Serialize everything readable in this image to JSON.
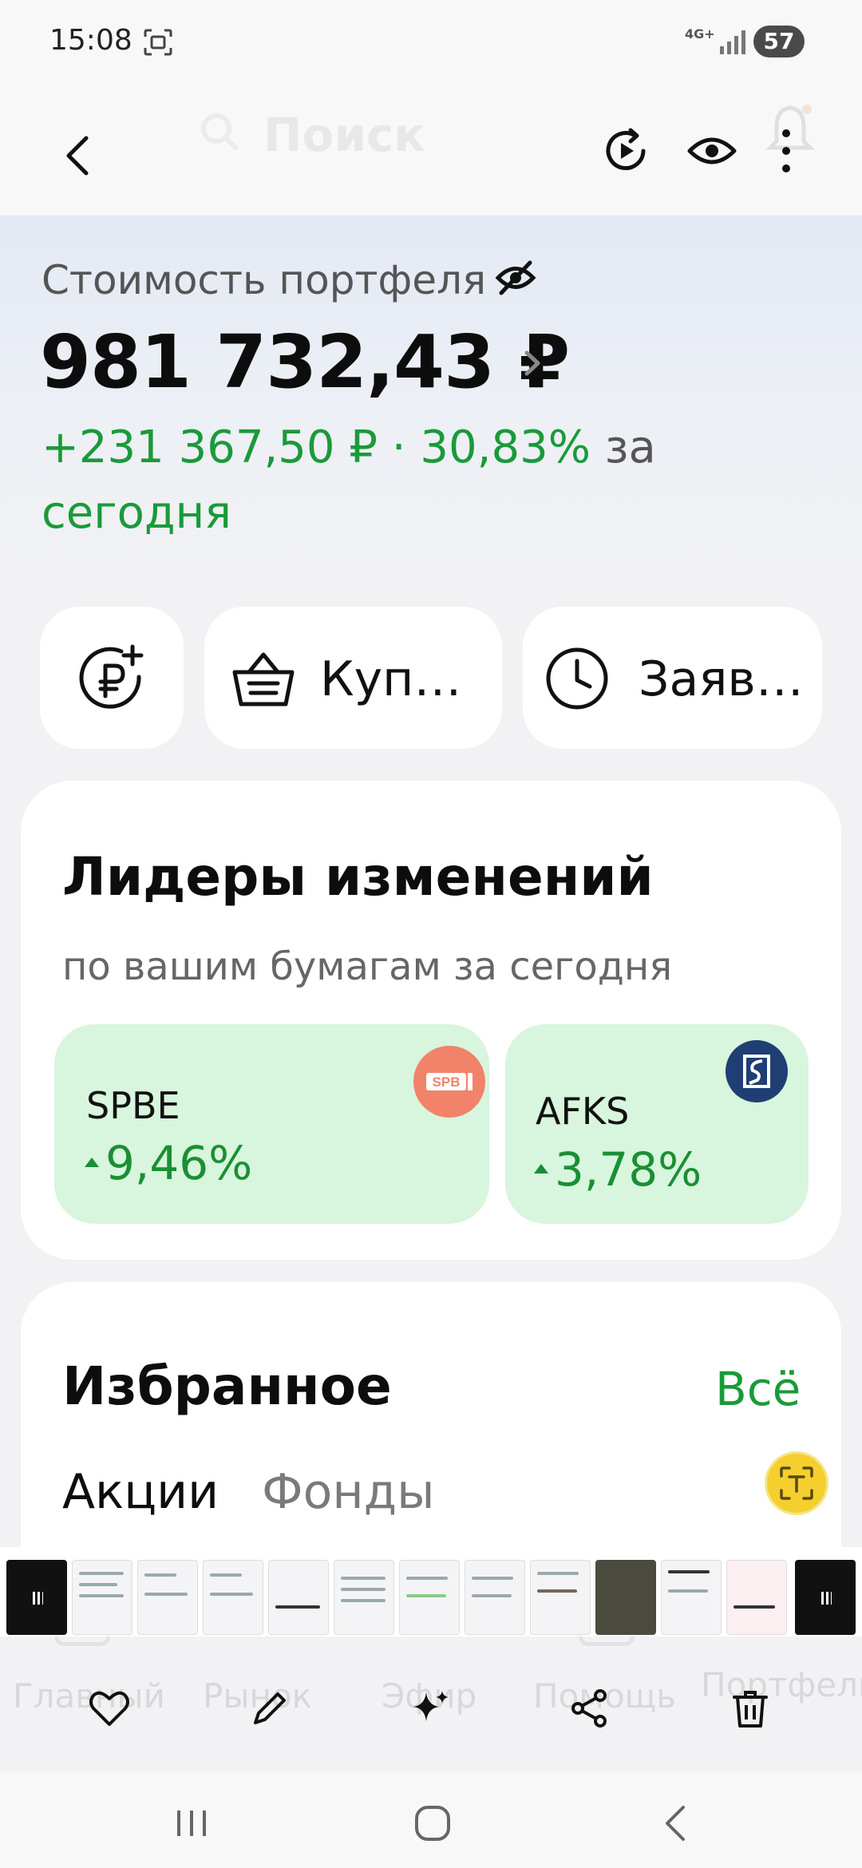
{
  "status_bar": {
    "time": "15:08",
    "network": "4G+",
    "battery": "57"
  },
  "header": {
    "ghost_search_placeholder": "Поиск",
    "icons": [
      "back-arrow-icon",
      "refresh-play-icon",
      "eye-icon",
      "more-vertical-icon",
      "bell-icon"
    ]
  },
  "portfolio": {
    "label": "Стоимость портфеля",
    "value": "981 732,43 ₽",
    "change_amount": "+231 367,50 ₽ · 30,83%",
    "change_suffix": "за",
    "change_period": "сегодня"
  },
  "actions": {
    "topup_icon": "ruble-plus-icon",
    "buy_label": "Куп…",
    "orders_label": "Заяв…"
  },
  "leaders": {
    "title": "Лидеры изменений",
    "subtitle": "по вашим бумагам за сегодня",
    "items": [
      {
        "ticker": "SPBE",
        "change": "9,46%",
        "logo_text": "SPB",
        "logo_color": "#f2826a"
      },
      {
        "ticker": "AFKS",
        "change": "3,78%",
        "logo_color": "#1f3e74"
      }
    ]
  },
  "favorites": {
    "title": "Избранное",
    "all_link": "Всё",
    "tabs": [
      "Акции",
      "Фонды"
    ]
  },
  "ghost_bottom_nav": [
    "Главный",
    "Рынок",
    "Эфир",
    "Помощь",
    "Портфель"
  ],
  "colors": {
    "accent_green": "#1a9a3a",
    "tile_green": "#d8f5dd",
    "background": "#f2f2f4"
  }
}
